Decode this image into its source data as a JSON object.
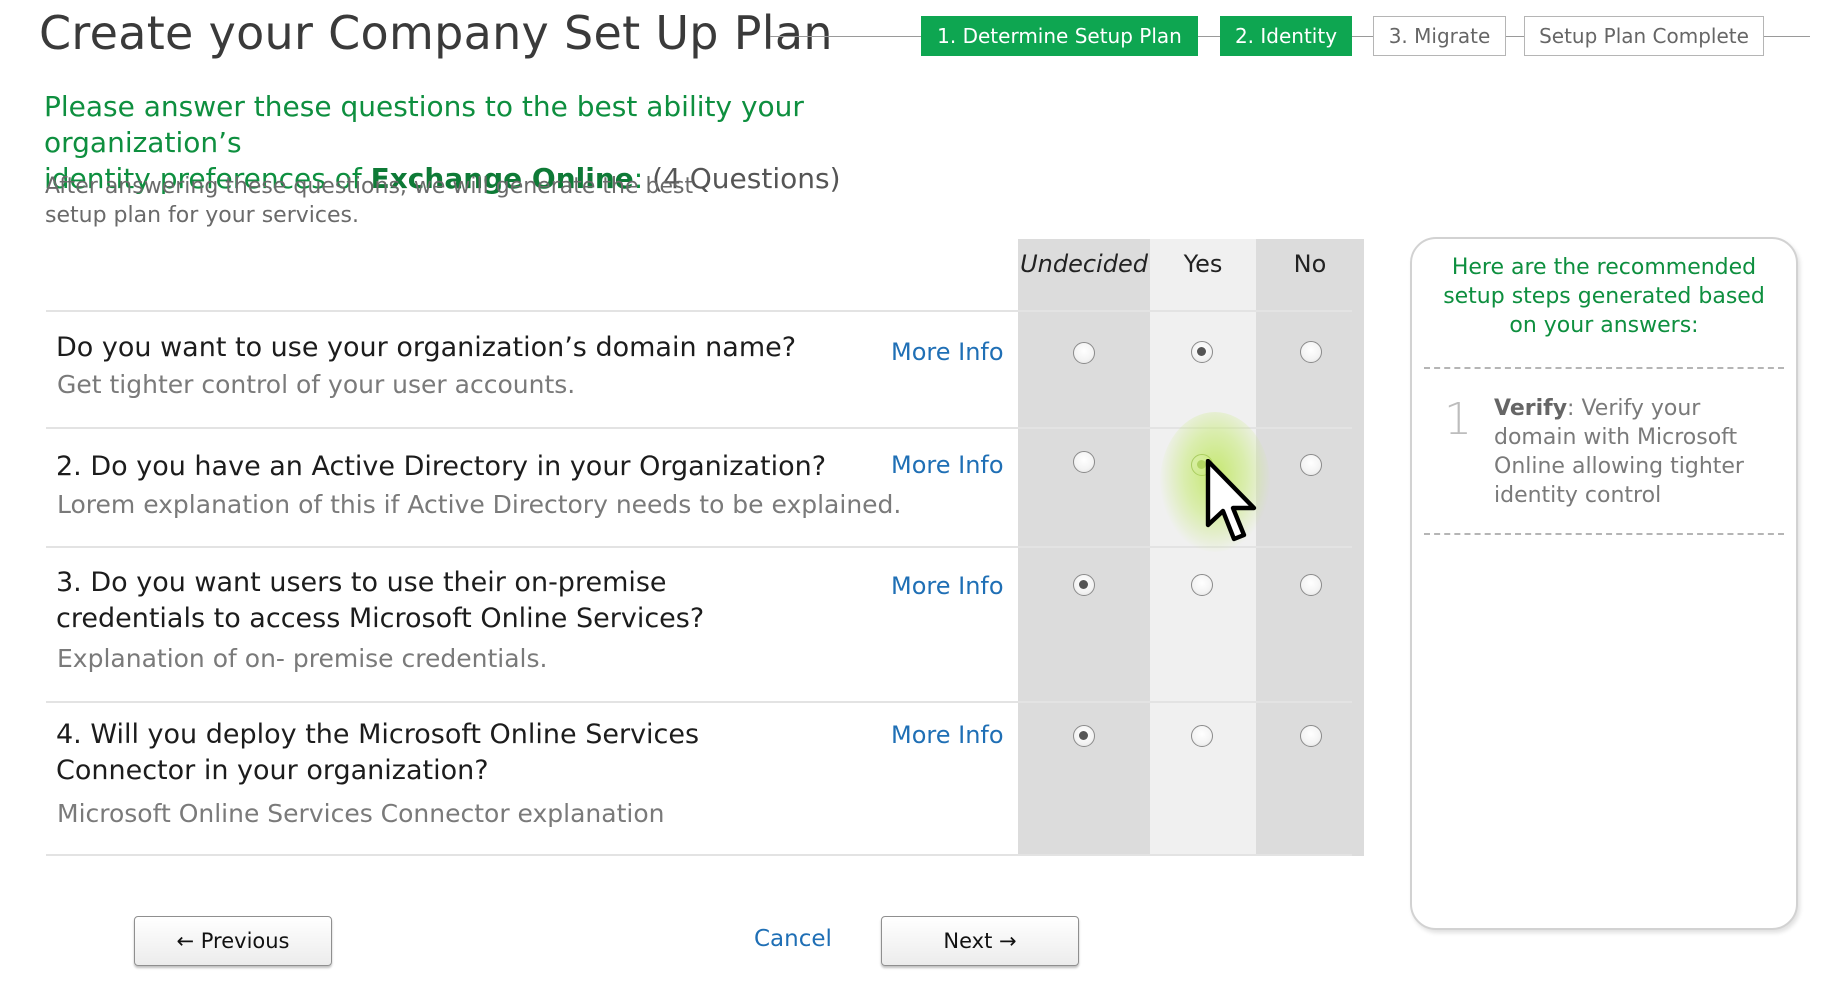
{
  "page": {
    "title": "Create your Company Set Up Plan"
  },
  "steps": [
    {
      "label": "1.  Determine Setup Plan",
      "state": "active"
    },
    {
      "label": "2. Identity",
      "state": "active"
    },
    {
      "label": "3. Migrate",
      "state": "inactive"
    },
    {
      "label": "Setup Plan Complete",
      "state": "inactive"
    }
  ],
  "intro": {
    "heading_line1": "Please answer these questions to the best ability your organization’s",
    "heading_line2_prefix": "identity preferences of ",
    "heading_product": "Exchange Online",
    "heading_colon": ":",
    "heading_count": " (4 Questions)",
    "sub_line1": "After answering these questions, we will generate the best",
    "sub_line2": "setup plan for your services."
  },
  "columns": {
    "undecided": "Undecided",
    "yes": "Yes",
    "no": "No"
  },
  "questions": [
    {
      "title_line1": "Do you want to use your organization’s domain name?",
      "title_line2": "",
      "description": "Get tighter control of your user accounts.",
      "more_info": "More Info",
      "answer": "yes"
    },
    {
      "title_line1": "2. Do you have an Active Directory in your Organization?",
      "title_line2": "",
      "description": "Lorem explanation of this if Active Directory needs to be explained.",
      "more_info": "More Info",
      "answer": "yes-hover"
    },
    {
      "title_line1": "3. Do you want users to use their on-premise",
      "title_line2": "credentials to access Microsoft Online Services?",
      "description": "Explanation of on- premise credentials.",
      "more_info": "More Info",
      "answer": "undecided"
    },
    {
      "title_line1": "4. Will you deploy the Microsoft Online Services",
      "title_line2": "Connector in your organization?",
      "description": "Microsoft Online Services Connector explanation",
      "more_info": "More Info",
      "answer": "undecided"
    }
  ],
  "buttons": {
    "previous": "← Previous",
    "cancel": "Cancel",
    "next": "Next →"
  },
  "recommendation": {
    "title_line1": "Here are the recommended",
    "title_line2": "setup steps generated based",
    "title_line3": "on your answers:",
    "steps": [
      {
        "number": "1",
        "label": "Verify",
        "text_line1": ":  Verify your",
        "text_line2": "domain with Microsoft",
        "text_line3": "Online  allowing tighter",
        "text_line4": "identity control"
      }
    ]
  },
  "icons": {
    "cursor": "mouse-pointer-icon",
    "prev_arrow": "arrow-left",
    "next_arrow": "arrow-right"
  },
  "colors": {
    "accent_green": "#0ea651",
    "heading_green": "#0e8f3f",
    "link_blue": "#1f6fb5"
  }
}
